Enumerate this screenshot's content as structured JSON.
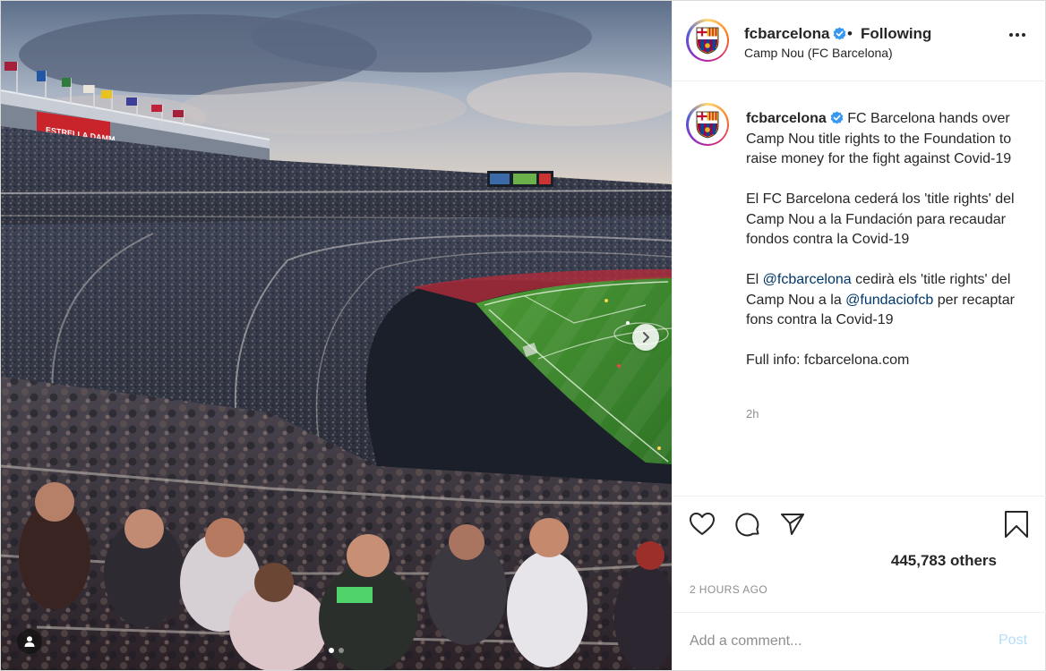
{
  "post": {
    "username": "fcbarcelona",
    "separator": "•",
    "follow_status": "Following",
    "location": "Camp Nou (FC Barcelona)"
  },
  "media": {
    "banner_text": "ESTRELLA DAMM",
    "carousel_count": 2,
    "carousel_index": 0
  },
  "caption": {
    "username": "fcbarcelona",
    "line1": "FC Barcelona hands over Camp Nou title rights to the Foundation to raise money for the fight against Covid-19",
    "para2": "El FC Barcelona cederá los 'title rights' del Camp Nou a la Fundación para recaudar fondos contra la Covid-19",
    "para3_pre": "El ",
    "para3_mention1": "@fcbarcelona",
    "para3_mid": " cedirà els 'title rights' del Camp Nou a la ",
    "para3_mention2": "@fundaciofcb",
    "para3_post": " per recaptar fons contra la Covid-19",
    "para4": "Full info: fcbarcelona.com",
    "time": "2h"
  },
  "actions": {
    "likes": "445,783 others",
    "posted_ago": "2 HOURS AGO"
  },
  "comment": {
    "placeholder": "Add a comment...",
    "post_label": "Post"
  },
  "icons": {
    "like": "heart-icon",
    "comment": "comment-icon",
    "share": "paper-plane-icon",
    "save": "bookmark-icon",
    "more": "more-options-icon",
    "next": "chevron-right-icon",
    "tags": "user-tag-icon",
    "verified": "verified-badge-icon"
  },
  "colors": {
    "verified": "#3897f0",
    "mention": "#00376b",
    "post_button": "#b2dffc",
    "pitch": "#3f8a2f",
    "muted": "#8e8e8e"
  }
}
